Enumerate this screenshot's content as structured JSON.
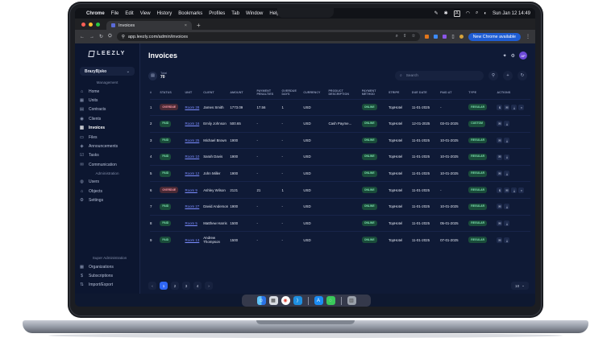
{
  "menubar": {
    "apple": "",
    "app_name": "Chrome",
    "menus": [
      "File",
      "Edit",
      "View",
      "History",
      "Bookmarks",
      "Profiles",
      "Tab",
      "Window",
      "Help"
    ],
    "clock": "Sun Jan 12  14:49",
    "input_source": "A"
  },
  "browser": {
    "tab_title": "Invoices",
    "tab_close": "×",
    "new_tab": "+",
    "url": "app.leezly.com/admin/invoices",
    "new_chrome_label": "New Chrome available"
  },
  "app": {
    "logo": "LEEZLY",
    "org_selector": "BrazyBjsko",
    "sections": {
      "management": "Management",
      "administration": "Administration",
      "super_admin": "Super Administration"
    },
    "management_items": [
      {
        "label": "Home",
        "icon": "home-icon",
        "glyph": "⌂"
      },
      {
        "label": "Units",
        "icon": "units-icon",
        "glyph": "▦"
      },
      {
        "label": "Contracts",
        "icon": "contracts-icon",
        "glyph": "▤"
      },
      {
        "label": "Clients",
        "icon": "clients-icon",
        "glyph": "◉"
      },
      {
        "label": "Invoices",
        "icon": "invoices-icon",
        "glyph": "▥"
      },
      {
        "label": "Files",
        "icon": "files-icon",
        "glyph": "▭"
      },
      {
        "label": "Announcements",
        "icon": "announcements-icon",
        "glyph": "◈"
      },
      {
        "label": "Tasks",
        "icon": "tasks-icon",
        "glyph": "☑"
      },
      {
        "label": "Communication",
        "icon": "communication-icon",
        "glyph": "✉"
      }
    ],
    "admin_items": [
      {
        "label": "Users",
        "icon": "users-icon",
        "glyph": "◍"
      },
      {
        "label": "Objects",
        "icon": "objects-icon",
        "glyph": "⌂"
      },
      {
        "label": "Settings",
        "icon": "settings-icon",
        "glyph": "⚙"
      }
    ],
    "super_items": [
      {
        "label": "Organizations",
        "icon": "organizations-icon",
        "glyph": "▦"
      },
      {
        "label": "Subscriptions",
        "icon": "subscriptions-icon",
        "glyph": "$"
      },
      {
        "label": "Import/Export",
        "icon": "import-export-icon",
        "glyph": "⇅"
      }
    ],
    "page_title": "Invoices",
    "avatar_initials": "AP",
    "total_label": "Total",
    "total_value": "70",
    "search_placeholder": "Search",
    "columns": [
      "#",
      "STATUS",
      "UNIT",
      "CLIENT",
      "AMOUNT",
      "PAYMENT PENALTIES",
      "OVERDUE DAYS",
      "CURRENCY",
      "PRODUCT DESCRIPTION",
      "PAYMENT METHOD",
      "STRIPE",
      "DUE DATE",
      "PAID AT",
      "TYPE",
      "ACTIONS"
    ],
    "rows": [
      {
        "n": "1",
        "status": "OVERDUE",
        "unit": "Room 28",
        "client": "James Smith",
        "amount": "1773.09",
        "penalty": "17.56",
        "overdue": "1",
        "currency": "USD",
        "desc": "",
        "method": "ONLINE",
        "stripe": "TopHotel",
        "due": "11-01-2025",
        "paid": "-",
        "type": "REGULAR"
      },
      {
        "n": "2",
        "status": "PAID",
        "unit": "Room 16",
        "client": "Emily Johnson",
        "amount": "500.65",
        "penalty": "-",
        "overdue": "-",
        "currency": "USD",
        "desc": "Cash Payme...",
        "method": "ONLINE",
        "stripe": "TopHotel",
        "due": "12-01-2025",
        "paid": "03-01-2025",
        "type": "CUSTOM"
      },
      {
        "n": "3",
        "status": "PAID",
        "unit": "Room 25",
        "client": "Michael Brown",
        "amount": "1900",
        "penalty": "-",
        "overdue": "-",
        "currency": "USD",
        "desc": "",
        "method": "ONLINE",
        "stripe": "TopHotel",
        "due": "11-01-2025",
        "paid": "10-01-2025",
        "type": "REGULAR"
      },
      {
        "n": "4",
        "status": "PAID",
        "unit": "Room 10",
        "client": "Sarah Davis",
        "amount": "1900",
        "penalty": "-",
        "overdue": "-",
        "currency": "USD",
        "desc": "",
        "method": "ONLINE",
        "stripe": "TopHotel",
        "due": "11-01-2025",
        "paid": "10-01-2025",
        "type": "REGULAR"
      },
      {
        "n": "5",
        "status": "PAID",
        "unit": "Room 12",
        "client": "John Miller",
        "amount": "1900",
        "penalty": "-",
        "overdue": "-",
        "currency": "USD",
        "desc": "",
        "method": "ONLINE",
        "stripe": "TopHotel",
        "due": "11-01-2025",
        "paid": "10-01-2025",
        "type": "REGULAR"
      },
      {
        "n": "6",
        "status": "OVERDUE",
        "unit": "Room 9",
        "client": "Ashley Wilson",
        "amount": "2121",
        "penalty": "21",
        "overdue": "1",
        "currency": "USD",
        "desc": "",
        "method": "ONLINE",
        "stripe": "TopHotel",
        "due": "11-01-2025",
        "paid": "-",
        "type": "REGULAR"
      },
      {
        "n": "7",
        "status": "PAID",
        "unit": "Room 27",
        "client": "David Anderson",
        "amount": "1900",
        "penalty": "-",
        "overdue": "-",
        "currency": "USD",
        "desc": "",
        "method": "ONLINE",
        "stripe": "TopHotel",
        "due": "11-01-2025",
        "paid": "10-01-2025",
        "type": "REGULAR"
      },
      {
        "n": "8",
        "status": "PAID",
        "unit": "Room 5",
        "client": "Matthew Harris",
        "amount": "1500",
        "penalty": "-",
        "overdue": "-",
        "currency": "USD",
        "desc": "",
        "method": "ONLINE",
        "stripe": "TopHotel",
        "due": "11-01-2025",
        "paid": "05-01-2025",
        "type": "REGULAR"
      },
      {
        "n": "9",
        "status": "PAID",
        "unit": "Room 13",
        "client": "Andrew Thompson",
        "amount": "1500",
        "penalty": "-",
        "overdue": "-",
        "currency": "USD",
        "desc": "",
        "method": "ONLINE",
        "stripe": "TopHotel",
        "due": "11-01-2025",
        "paid": "07-01-2025",
        "type": "REGULAR"
      }
    ],
    "pager": {
      "prev": "‹",
      "pages": [
        "1",
        "2",
        "3",
        "4"
      ],
      "next": "›",
      "per_page": "10"
    }
  },
  "colors": {
    "accent": "#2f67f6",
    "paid": "#7de0b0",
    "overdue": "#ff9aa9",
    "background": "#0f1a36"
  }
}
